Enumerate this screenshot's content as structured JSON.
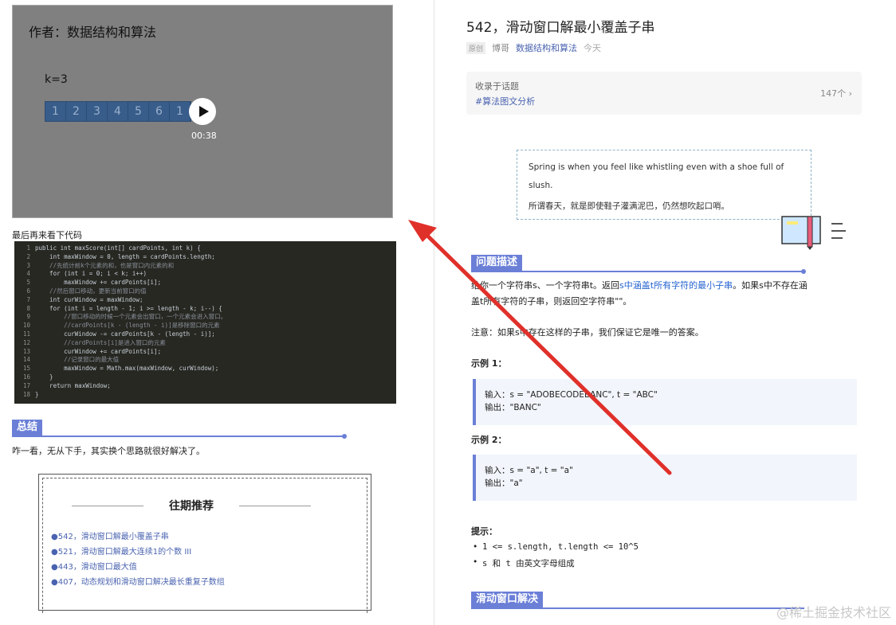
{
  "left": {
    "video": {
      "author": "作者：数据结构和算法",
      "k_label": "k=3",
      "array": [
        "1",
        "2",
        "3",
        "4",
        "5",
        "6",
        "1"
      ],
      "time": "00:38",
      "play_icon": "play-icon"
    },
    "code_caption": "最后再来看下代码",
    "code_lines": [
      {
        "n": "1",
        "t": "public int maxScore(int[] cardPoints, int k) {"
      },
      {
        "n": "2",
        "t": "    int maxWindow = 0, length = cardPoints.length;"
      },
      {
        "n": "3",
        "t": "    //先统计前k个元素的和，也是窗口内元素的和"
      },
      {
        "n": "4",
        "t": "    for (int i = 0; i < k; i++)"
      },
      {
        "n": "5",
        "t": "        maxWindow += cardPoints[i];"
      },
      {
        "n": "6",
        "t": "    //然后窗口移动，更新当前窗口的值"
      },
      {
        "n": "7",
        "t": "    int curWindow = maxWindow;"
      },
      {
        "n": "8",
        "t": "    for (int i = length - 1; i >= length - k; i--) {"
      },
      {
        "n": "9",
        "t": "        //窗口移动的时候一个元素会出窗口，一个元素会进入窗口。"
      },
      {
        "n": "10",
        "t": "        //cardPoints[k - (length - i)]是移除窗口的元素"
      },
      {
        "n": "11",
        "t": "        curWindow -= cardPoints[k - (length - i)];"
      },
      {
        "n": "12",
        "t": "        //cardPoints[i]是进入窗口的元素"
      },
      {
        "n": "13",
        "t": "        curWindow += cardPoints[i];"
      },
      {
        "n": "14",
        "t": "        //记录窗口的最大值"
      },
      {
        "n": "15",
        "t": "        maxWindow = Math.max(maxWindow, curWindow);"
      },
      {
        "n": "16",
        "t": "    }"
      },
      {
        "n": "17",
        "t": "    return maxWindow;"
      },
      {
        "n": "18",
        "t": "}"
      }
    ],
    "summary_heading": "总结",
    "summary_text": "咋一看，无从下手，其实换个思路就很好解决了。",
    "recommend": {
      "title": "往期推荐",
      "items": [
        "●542，滑动窗口解最小覆盖子串",
        "●521，滑动窗口解最大连续1的个数 III",
        "●443，滑动窗口最大值",
        "●407，动态规划和滑动窗口解决最长重复子数组"
      ]
    }
  },
  "right": {
    "title": "542，滑动窗口解最小覆盖子串",
    "meta": {
      "badge": "原创",
      "author": "博哥",
      "account": "数据结构和算法",
      "date": "今天"
    },
    "topic": {
      "label": "收录于话题",
      "tag": "#算法图文分析",
      "count": "147个 ›"
    },
    "quote": {
      "en": "Spring is when you feel like whistling even with a shoe full of slush.",
      "cn": "所谓春天，就是即使鞋子灌满泥巴，仍然想吹起口哨。"
    },
    "problem_heading": "问题描述",
    "problem_line1_pre": "给你一个字符串s、一个字符串t。返回",
    "problem_line1_hl": "s中涵盖t所有字符的最小子串",
    "problem_line1_post": "。如果s中不存在涵",
    "problem_line2": "盖t所有字符的子串，则返回空字符串\"\"。",
    "note": "注意：如果s中存在这样的子串，我们保证它是唯一的答案。",
    "example1_label": "示例 1：",
    "example1_input": "输入：s = \"ADOBECODEBANC\", t = \"ABC\"",
    "example1_output": "输出：\"BANC\"",
    "example2_label": "示例 2：",
    "example2_input": "输入：s = \"a\", t = \"a\"",
    "example2_output": "输出：\"a\"",
    "hint_label": "提示：",
    "hints": [
      "1 <= s.length, t.length <= 10^5",
      "s 和 t 由英文字母组成"
    ],
    "sliding_heading": "滑动窗口解决",
    "watermark": "@稀土掘金技术社区"
  },
  "colors": {
    "accent": "#6b7fd7",
    "link": "#4a63b0",
    "arrow": "#e0302a",
    "code_bg": "#272822"
  }
}
